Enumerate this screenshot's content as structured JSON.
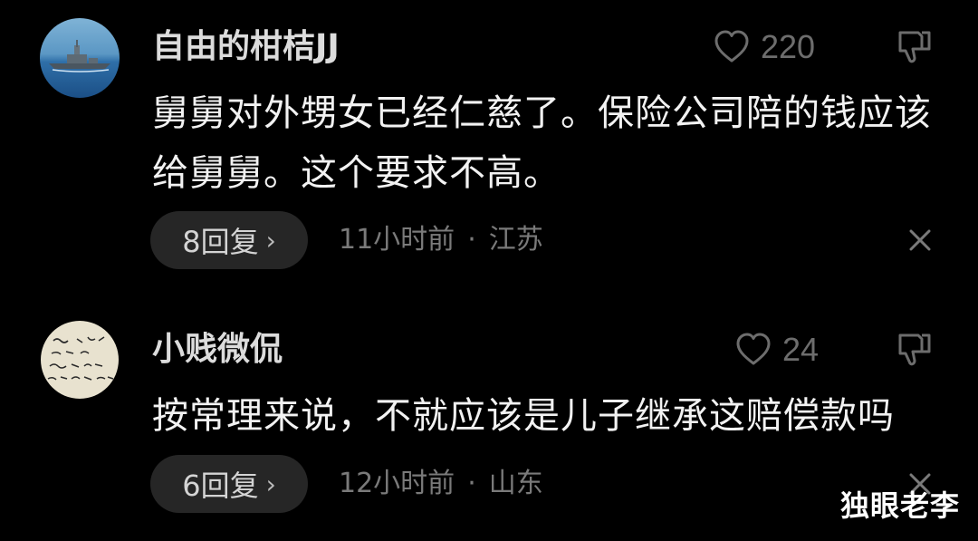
{
  "comments": [
    {
      "username": "自由的柑桔JJ",
      "avatar_icon": "warship-photo",
      "likes": "220",
      "content": "舅舅对外甥女已经仁慈了。保险公司陪的钱应该给舅舅。这个要求不高。",
      "replies": "8回复",
      "reply_chevron": "›",
      "time": "11小时前",
      "separator": "·",
      "location": "江苏"
    },
    {
      "username": "小贱微侃",
      "avatar_icon": "handwriting-avatar",
      "likes": "24",
      "content": "按常理来说，不就应该是儿子继承这赔偿款吗",
      "replies": "6回复",
      "reply_chevron": "›",
      "time": "12小时前",
      "separator": "·",
      "location": "山东"
    }
  ],
  "watermark": "独眼老李",
  "colors": {
    "background": "#000000",
    "reply_pill": "#262626",
    "muted_text": "#7a7a7a",
    "icon_gray": "#6d6d6d"
  }
}
